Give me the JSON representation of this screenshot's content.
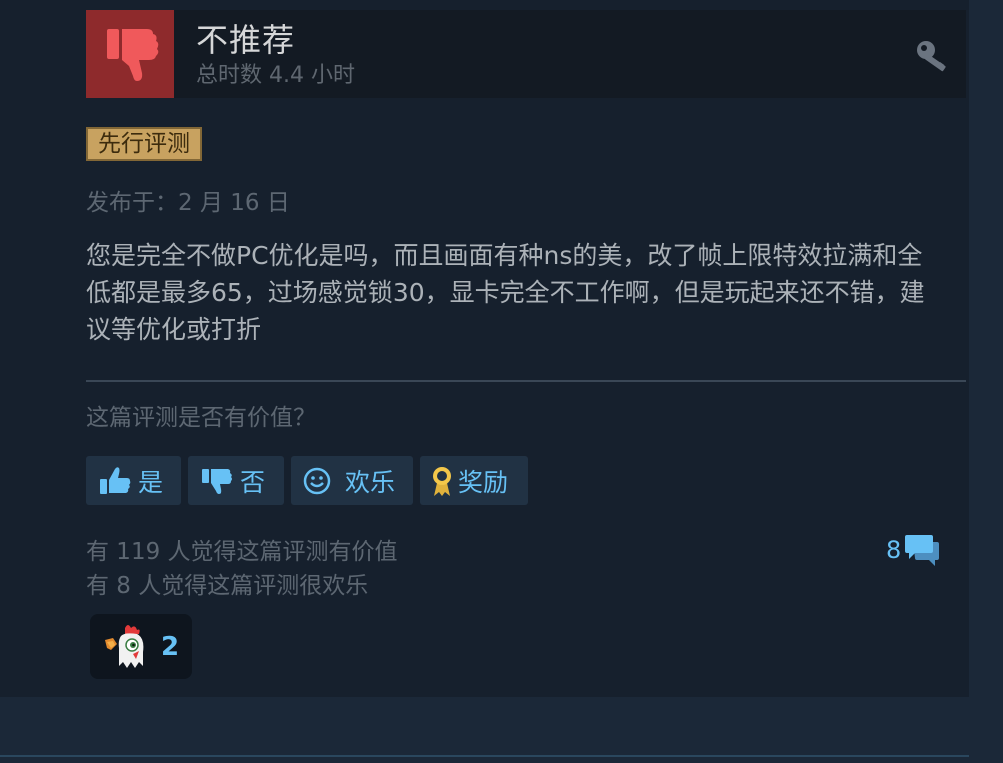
{
  "review": {
    "verdict": "不推荐",
    "hours": "总时数 4.4 小时",
    "early_access_badge": "先行评测",
    "posted": "发布于：2 月 16 日",
    "body": "您是完全不做PC优化是吗，而且画面有种ns的美，改了帧上限特效拉满和全低都是最多65，过场感觉锁30，显卡完全不工作啊，但是玩起来还不错，建议等优化或打折"
  },
  "helpful": {
    "question": "这篇评测是否有价值？",
    "yes_label": "是",
    "no_label": "否",
    "funny_label": "欢乐",
    "award_label": "奖励",
    "helpful_stat": "有 119 人觉得这篇评测有价值",
    "funny_stat": "有 8 人觉得这篇评测很欢乐"
  },
  "comments": {
    "count": "8"
  },
  "awards": [
    {
      "icon": "chicken-award-icon",
      "count": "2"
    }
  ],
  "colors": {
    "background": "#1b2838",
    "panel": "#16202d",
    "thumb_down_bg": "#8e2a2c",
    "accent_blue": "#67c1f5",
    "badge_gold": "#c8a260"
  },
  "icons": {
    "verdict": "thumbs-down-icon",
    "product_access": "key-icon",
    "yes": "thumbs-up-icon",
    "no": "thumbs-down-icon",
    "funny": "smiley-icon",
    "award": "award-ribbon-icon",
    "comments": "speech-bubbles-icon"
  }
}
